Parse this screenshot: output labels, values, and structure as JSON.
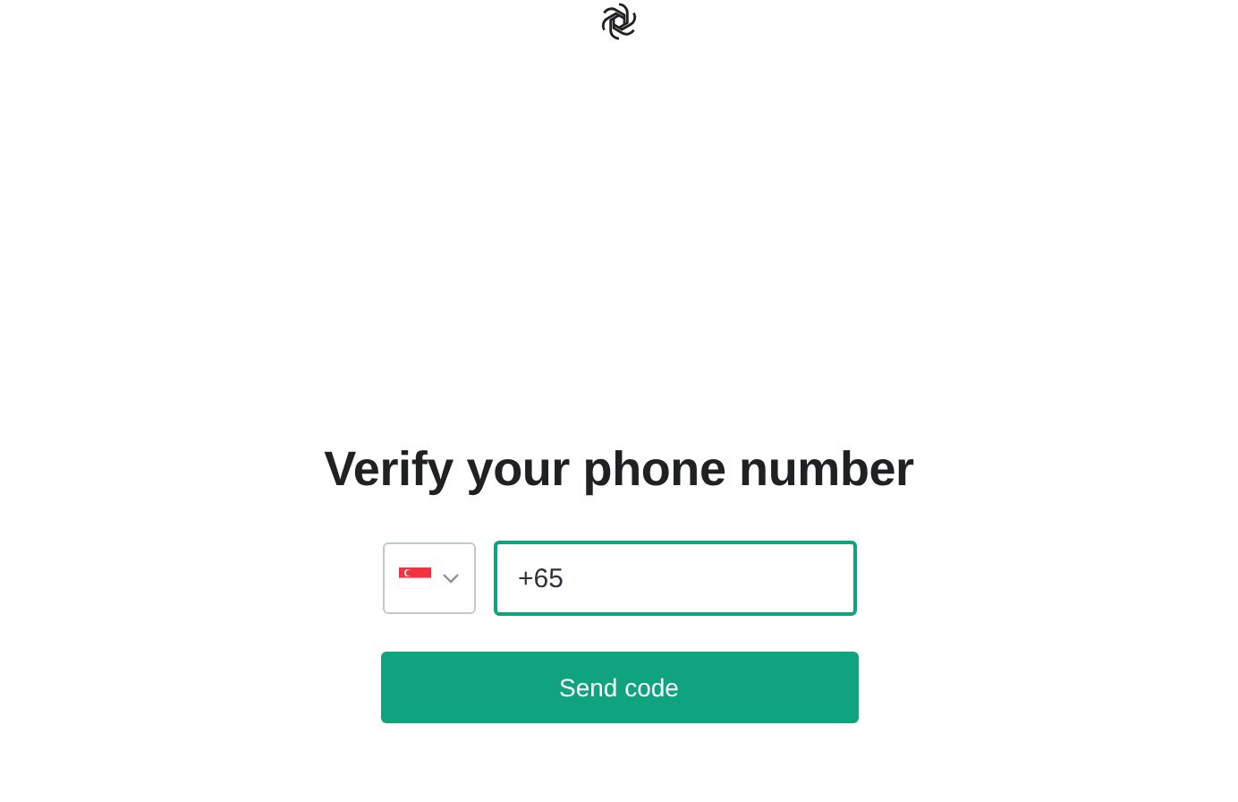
{
  "heading": "Verify your phone number",
  "phone": {
    "country_selected": true,
    "value": "+65 ",
    "focused": true
  },
  "submit": {
    "label": "Send code"
  }
}
